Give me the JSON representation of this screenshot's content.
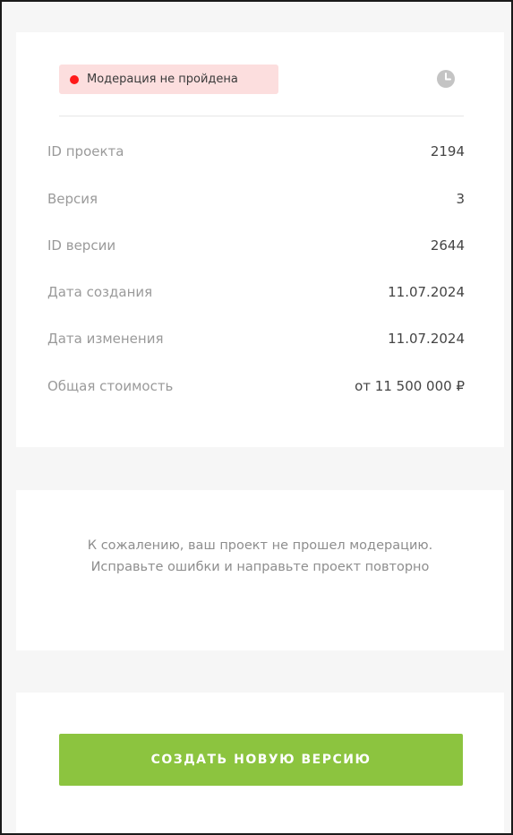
{
  "status": {
    "label": "Модерация не пройдена",
    "dot_color": "#ff1a1a",
    "badge_bg": "#fcdede",
    "icon": "clock-icon"
  },
  "details": [
    {
      "label": "ID проекта",
      "value": "2194"
    },
    {
      "label": "Версия",
      "value": "3"
    },
    {
      "label": "ID версии",
      "value": "2644"
    },
    {
      "label": "Дата создания",
      "value": "11.07.2024"
    },
    {
      "label": "Дата изменения",
      "value": "11.07.2024"
    },
    {
      "label": "Общая стоимость",
      "value": "от 11 500 000 ₽"
    }
  ],
  "message": {
    "text": "К сожалению, ваш проект не прошел модерацию. Исправьте ошибки и направьте проект повторно"
  },
  "actions": {
    "create_label": "СОЗДАТЬ НОВУЮ ВЕРСИЮ",
    "button_color": "#8cc43f"
  }
}
